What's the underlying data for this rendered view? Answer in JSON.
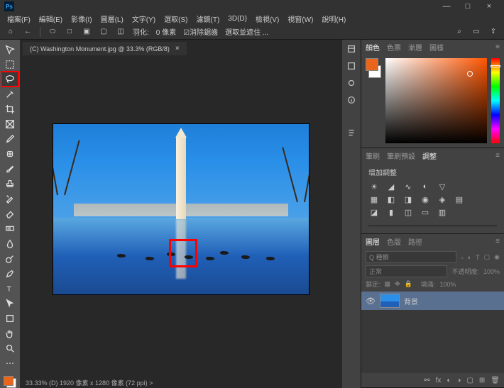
{
  "app": {
    "logo": "Ps"
  },
  "window": {
    "min": "—",
    "max": "□",
    "close": "×"
  },
  "menu": [
    "檔案(F)",
    "編輯(E)",
    "影像(I)",
    "圖層(L)",
    "文字(Y)",
    "選取(S)",
    "濾鏡(T)",
    "3D(D)",
    "檢視(V)",
    "視窗(W)",
    "說明(H)"
  ],
  "optbar": {
    "feather_label": "羽化:",
    "feather_value": "0 像素",
    "antialias": "☑消除鋸齒",
    "mode_label": "選取並遮住 ..."
  },
  "tab": {
    "title": "(C) Washington Monument.jpg @ 33.3% (RGB/8)",
    "close": "×"
  },
  "status": "33.33%   (D) 1920 像素 x 1280 像素 (72 ppi)   >",
  "panels": {
    "color_tabs": [
      "顏色",
      "色票",
      "漸層",
      "圖樣"
    ],
    "style_tabs": [
      "筆刷",
      "筆刷預設",
      "調整"
    ],
    "adj_label": "增加調整",
    "layer_tabs": [
      "圖層",
      "色版",
      "路徑"
    ],
    "search_ph": "Q 種類",
    "opacity_label": "不透明度:",
    "opacity_val": "100%",
    "blend": "正常",
    "lock_label": "鎖定:",
    "fill_label": "填滿:",
    "fill_val": "100%",
    "layer_name": "背景"
  },
  "colors": {
    "fg": "#e8651b",
    "bg": "#ffffff"
  }
}
